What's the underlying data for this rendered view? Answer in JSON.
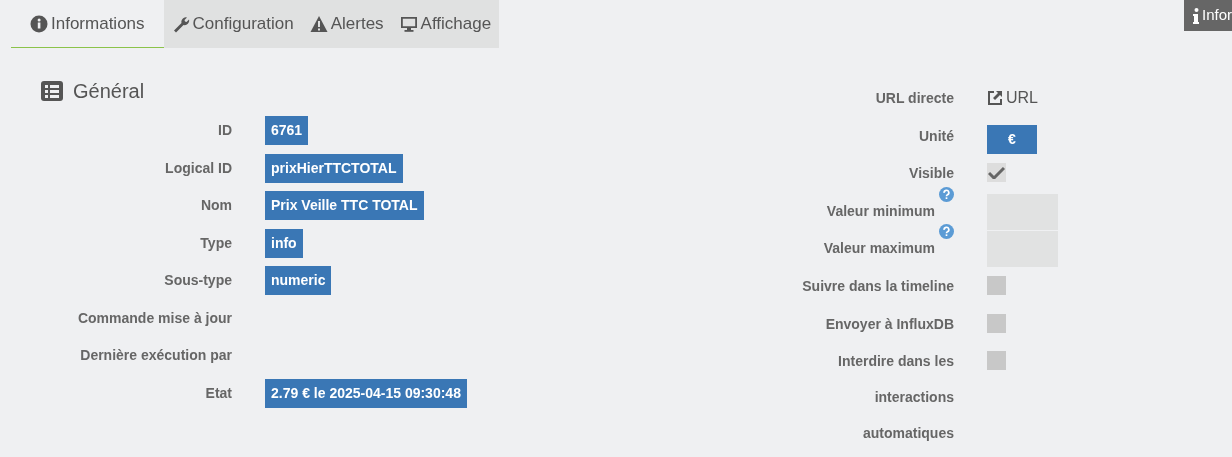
{
  "tabs": [
    {
      "label": "Informations",
      "selected": true
    },
    {
      "label": "Configuration",
      "selected": false
    },
    {
      "label": "Alertes",
      "selected": false
    },
    {
      "label": "Affichage",
      "selected": false
    }
  ],
  "corner_button": {
    "label": "Infor"
  },
  "section": {
    "title": "Général"
  },
  "left_fields": [
    {
      "label": "ID",
      "value": "6761"
    },
    {
      "label": "Logical ID",
      "value": "prixHierTTCTOTAL"
    },
    {
      "label": "Nom",
      "value": "Prix Veille TTC TOTAL"
    },
    {
      "label": "Type",
      "value": "info"
    },
    {
      "label": "Sous-type",
      "value": "numeric"
    },
    {
      "label": "Commande mise à jour"
    },
    {
      "label": "Dernière exécution par"
    },
    {
      "label": "Etat",
      "value": "2.79 € le 2025-04-15 09:30:48"
    }
  ],
  "right_fields": [
    {
      "kind": "link",
      "label": "URL directe",
      "value": "URL"
    },
    {
      "kind": "badge",
      "label": "Unité",
      "value": "€"
    },
    {
      "kind": "checkbox",
      "label": "Visible",
      "checked": true
    },
    {
      "kind": "input",
      "label": "Valeur minimum",
      "help": true
    },
    {
      "kind": "input",
      "label": "Valeur maximum",
      "help": true
    },
    {
      "kind": "checkbox",
      "label": "Suivre dans la timeline",
      "checked": false
    },
    {
      "kind": "checkbox",
      "label": "Envoyer à InfluxDB",
      "checked": false
    },
    {
      "kind": "checkbox",
      "label": "Interdire dans les interactions automatiques",
      "checked": false
    }
  ]
}
